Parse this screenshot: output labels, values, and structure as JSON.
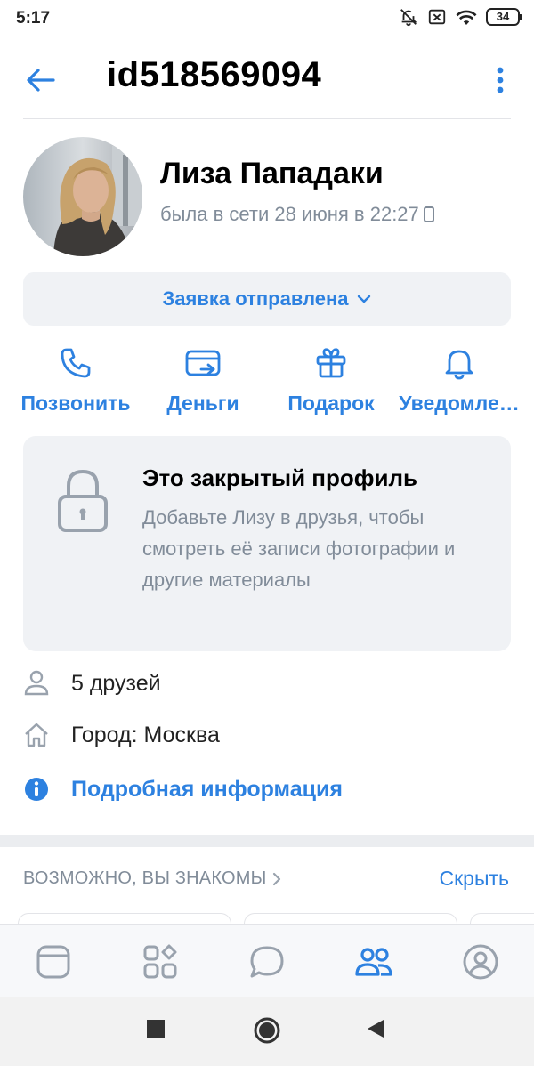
{
  "status_bar": {
    "time": "5:17",
    "battery": "34",
    "icons": [
      "mute-icon",
      "sim-off-icon",
      "wifi-icon",
      "battery-icon"
    ]
  },
  "header": {
    "title": "id518569094",
    "icons": [
      "back-arrow-icon",
      "more-vertical-icon"
    ]
  },
  "profile": {
    "name": "Лиза Пападаки",
    "last_seen": "была в сети 28 июня в 22:27"
  },
  "request_button": {
    "label": "Заявка отправлена"
  },
  "actions": [
    {
      "label": "Позвонить",
      "icon": "phone-icon"
    },
    {
      "label": "Деньги",
      "icon": "money-card-icon"
    },
    {
      "label": "Подарок",
      "icon": "gift-icon"
    },
    {
      "label": "Уведомле…",
      "icon": "bell-icon"
    }
  ],
  "closed_profile": {
    "title": "Это закрытый профиль",
    "text": "Добавьте Лизу в друзья, чтобы смотреть её записи фотографии и другие материалы"
  },
  "info": {
    "friends": "5 друзей",
    "city": "Город: Москва",
    "details_link": "Подробная информация"
  },
  "suggestions": {
    "header": "ВОЗМОЖНО, ВЫ ЗНАКОМЫ",
    "hide": "Скрыть"
  },
  "tab_bar": {
    "active": "friends",
    "tabs": [
      "news-icon",
      "services-icon",
      "messages-icon",
      "friends-icon",
      "profile-icon"
    ]
  },
  "colors": {
    "accent": "#2d81e0",
    "secondary_text": "#818c99",
    "card_bg": "#f0f2f5"
  }
}
